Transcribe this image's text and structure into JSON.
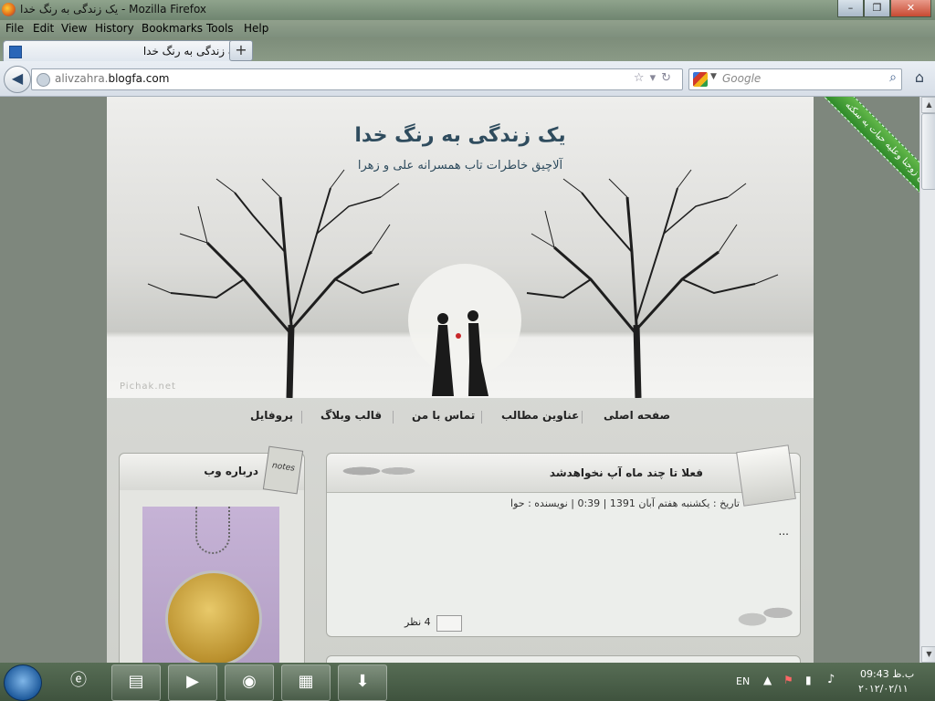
{
  "window": {
    "title": "یک زندگی به رنگ خدا - Mozilla Firefox"
  },
  "menu": [
    "File",
    "Edit",
    "View",
    "History",
    "Bookmarks",
    "Tools",
    "Help"
  ],
  "tab": {
    "label": "یک زندگی به رنگ خدا",
    "new_tab": "+"
  },
  "nav": {
    "url_host": "alivzahra.",
    "url_domain": "blogfa.com",
    "search_placeholder": "Google"
  },
  "blog": {
    "title": "یک زندگی به رنگ خدا",
    "subtitle": "آلاچیق خاطرات تاب همسرانه علی و زهرا",
    "watermark": "Pichak.net",
    "ribbon": "وتامن زوجنا وعلیه حیات به سکته",
    "nav": [
      "صفحه اصلی",
      "عناوین مطالب",
      "تماس با من",
      "قالب وبلاگ",
      "پروفایل"
    ]
  },
  "sidebar": {
    "header": "درباره وب",
    "notes_label": "notes"
  },
  "post": {
    "title": "فعلا تا چند ماه آپ نخواهدشد",
    "meta": "تاریخ : یکشنبه هفتم آبان 1391 | 0:39 | نویسنده : حوا",
    "body": "...",
    "comments": "4 نظر"
  },
  "taskbar": {
    "lang": "EN",
    "time": "09:43 ب.ظ",
    "date": "۲۰۱۲/۰۲/۱۱"
  },
  "colors": {
    "titleText": "#2f4c5e",
    "ribbon": "#3f9a33"
  }
}
